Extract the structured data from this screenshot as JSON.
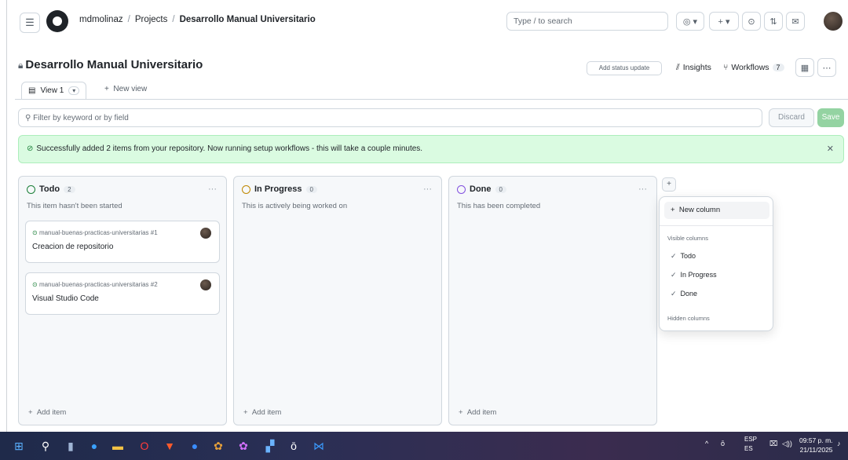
{
  "header": {
    "user": "mdmolinaz",
    "projects": "Projects",
    "project_name": "Desarrollo Manual Universitario",
    "search_placeholder": "Type / to search"
  },
  "project": {
    "title": "Desarrollo Manual Universitario",
    "status_update": "Add status update",
    "insights": "Insights",
    "workflows": "Workflows",
    "workflows_count": "7"
  },
  "views": {
    "view1": "View 1",
    "new_view": "New view"
  },
  "filter": {
    "placeholder": "Filter by keyword or by field",
    "discard": "Discard",
    "save": "Save"
  },
  "flash": {
    "message": "Successfully added 2 items from your repository. Now running setup workflows - this will take a couple minutes."
  },
  "columns": [
    {
      "name": "Todo",
      "count": "2",
      "description": "This item hasn't been started",
      "color": "#1a7f37",
      "add_item": "Add item",
      "cards": [
        {
          "repo": "manual-buenas-practicas-universitarias #1",
          "title": "Creacion de repositorio"
        },
        {
          "repo": "manual-buenas-practicas-universitarias #2",
          "title": "Visual Studio Code"
        }
      ]
    },
    {
      "name": "In Progress",
      "count": "0",
      "description": "This is actively being worked on",
      "color": "#bf8700",
      "add_item": "Add item",
      "cards": []
    },
    {
      "name": "Done",
      "count": "0",
      "description": "This has been completed",
      "color": "#8250df",
      "add_item": "Add item",
      "cards": []
    }
  ],
  "column_menu": {
    "new_column": "New column",
    "visible_heading": "Visible columns",
    "visible": [
      "Todo",
      "In Progress",
      "Done"
    ],
    "hidden_heading": "Hidden columns"
  },
  "taskbar": {
    "lang": "ESP",
    "lang_sub": "ES",
    "time": "09:57 p. m.",
    "date": "21/11/2025"
  }
}
